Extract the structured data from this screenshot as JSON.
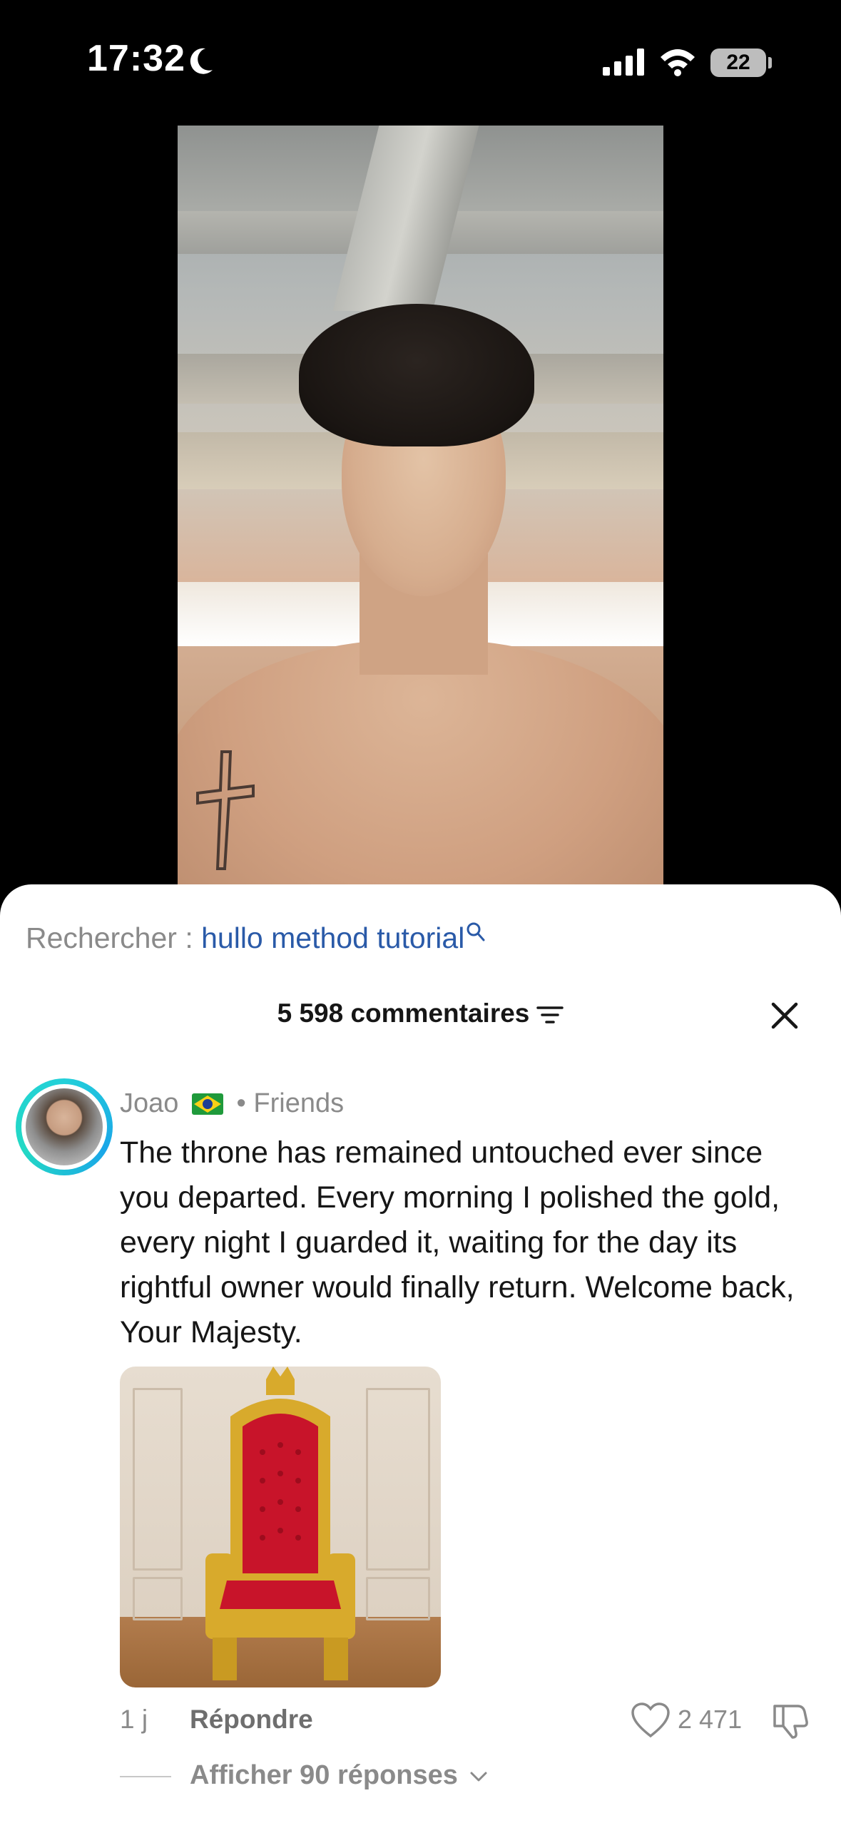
{
  "status_bar": {
    "time": "17:32",
    "battery": "22",
    "icons": [
      "moon-icon",
      "signal-icon",
      "wifi-icon",
      "battery-icon"
    ]
  },
  "search": {
    "prefix": "Rechercher : ",
    "query": "hullo method tutorial"
  },
  "comments_header": {
    "count_label": "5 598 commentaires"
  },
  "comment": {
    "author": "Joao",
    "flag": "brazil-flag",
    "separator": " • ",
    "relation": "Friends",
    "text": "The throne has remained untouched ever since you departed. Every morning I polished the gold, every night I guarded it, waiting for the day its rightful owner would finally return. Welcome back, Your Majesty.",
    "age": "1 j",
    "reply_label": "Répondre",
    "like_count": "2 471",
    "view_replies": "Afficher 90 réponses"
  },
  "colors": {
    "link_blue": "#2a5aa8",
    "muted_text": "#8a8a8a",
    "throne_red": "#c8142a",
    "throne_gold": "#d8aa2c",
    "avatar_ring": "#23d0d9"
  }
}
